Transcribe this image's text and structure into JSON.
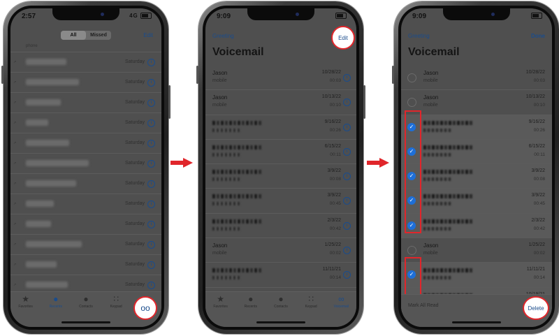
{
  "screen1": {
    "time": "2:57",
    "signal": "4G",
    "segment": {
      "all": "All",
      "missed": "Missed"
    },
    "edit": "Edit",
    "first_partial": "phone",
    "recent_rows": [
      {
        "day": "Saturday",
        "w": 58
      },
      {
        "day": "Saturday",
        "w": 76
      },
      {
        "day": "Saturday",
        "w": 50
      },
      {
        "day": "Saturday",
        "w": 32
      },
      {
        "day": "Saturday",
        "w": 62
      },
      {
        "day": "Saturday",
        "w": 90
      },
      {
        "day": "Saturday",
        "w": 72
      },
      {
        "day": "Saturday",
        "w": 40
      },
      {
        "day": "Saturday",
        "w": 36
      },
      {
        "day": "Saturday",
        "w": 80
      },
      {
        "day": "Saturday",
        "w": 44
      },
      {
        "day": "Saturday",
        "w": 60
      },
      {
        "day": "Saturday",
        "w": 34
      }
    ],
    "tabs": [
      "Favorites",
      "Recents",
      "Contacts",
      "Keypad",
      "Voicemail"
    ]
  },
  "screen2": {
    "time": "9:09",
    "greeting": "Greeting",
    "edit": "Edit",
    "title": "Voicemail",
    "rows": [
      {
        "name": "Jason",
        "sub": "mobile",
        "date": "10/28/22",
        "dur": "00:03"
      },
      {
        "name": "Jason",
        "sub": "mobile",
        "date": "10/13/22",
        "dur": "00:10"
      },
      {
        "date": "9/16/22",
        "dur": "00:26"
      },
      {
        "date": "6/15/22",
        "dur": "00:11"
      },
      {
        "date": "3/9/22",
        "dur": "00:08"
      },
      {
        "date": "3/9/22",
        "dur": "00:45"
      },
      {
        "date": "2/3/22",
        "dur": "00:42"
      },
      {
        "name": "Jason",
        "sub": "mobile",
        "date": "1/25/22",
        "dur": "00:02"
      },
      {
        "date": "11/11/21",
        "dur": "00:14"
      },
      {
        "date": "10/19/21",
        "dur": "00:29"
      }
    ],
    "tabs": [
      "Favorites",
      "Recents",
      "Contacts",
      "Keypad",
      "Voicemail"
    ]
  },
  "screen3": {
    "time": "9:09",
    "greeting": "Greeting",
    "done": "Done",
    "title": "Voicemail",
    "rows": [
      {
        "name": "Jason",
        "sub": "mobile",
        "date": "10/28/22",
        "dur": "00:03",
        "selected": false
      },
      {
        "name": "Jason",
        "sub": "mobile",
        "date": "10/13/22",
        "dur": "00:10",
        "selected": false
      },
      {
        "date": "9/16/22",
        "dur": "00:26",
        "selected": true
      },
      {
        "date": "6/15/22",
        "dur": "00:11",
        "selected": true
      },
      {
        "date": "3/9/22",
        "dur": "00:08",
        "selected": true
      },
      {
        "date": "3/9/22",
        "dur": "00:45",
        "selected": true
      },
      {
        "date": "2/3/22",
        "dur": "00:42",
        "selected": true
      },
      {
        "name": "Jason",
        "sub": "mobile",
        "date": "1/25/22",
        "dur": "00:02",
        "selected": false
      },
      {
        "date": "11/11/21",
        "dur": "00:14",
        "selected": true
      },
      {
        "date": "10/19/21",
        "dur": "00:29",
        "selected": true
      }
    ],
    "mark_all": "Mark All Read",
    "delete": "Delete"
  },
  "colors": {
    "accent": "#1a4c8c",
    "highlight": "#e0262b",
    "check": "#1e6fd8"
  }
}
